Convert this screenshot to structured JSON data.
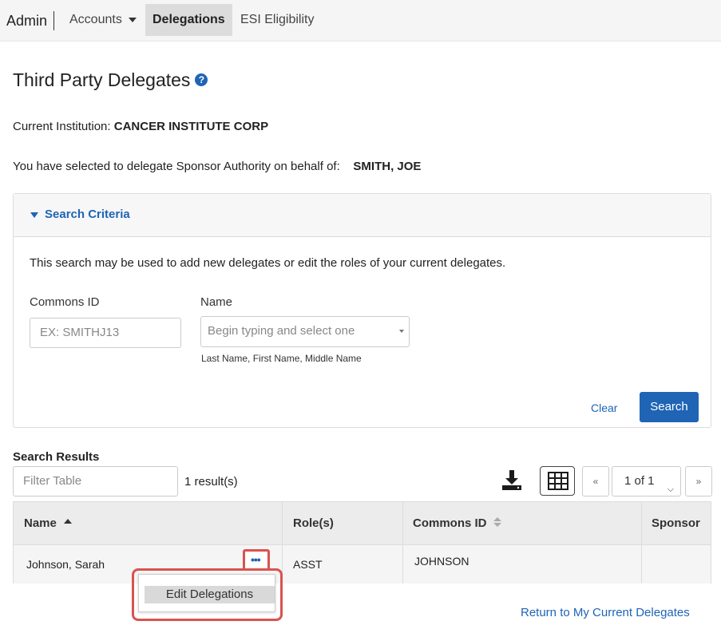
{
  "nav": {
    "brand": "Admin",
    "items": [
      {
        "label": "Accounts"
      },
      {
        "label": "Delegations"
      },
      {
        "label": "ESI Eligibility"
      }
    ]
  },
  "page": {
    "title": "Third Party Delegates",
    "institution_label": "Current Institution:",
    "institution_value": "CANCER INSTITUTE CORP",
    "delegate_label": "You have selected to delegate Sponsor Authority on behalf of:",
    "delegate_value": "SMITH, JOE"
  },
  "search_criteria": {
    "title": "Search Criteria",
    "description": "This search may be used to add new delegates or edit the roles of your current delegates.",
    "commons_id_label": "Commons ID",
    "commons_id_placeholder": "EX: SMITHJ13",
    "name_label": "Name",
    "name_placeholder": "Begin typing and select one",
    "name_hint": "Last Name, First Name, Middle Name",
    "clear_label": "Clear",
    "search_label": "Search"
  },
  "results": {
    "title": "Search Results",
    "filter_placeholder": "Filter Table",
    "count": "1 result(s)",
    "pagination": {
      "prev": "«",
      "current": "1 of 1",
      "next": "»"
    },
    "columns": [
      "Name",
      "Role(s)",
      "Commons ID",
      "Sponsor"
    ],
    "rows": [
      {
        "name": "Johnson, Sarah",
        "roles": "ASST",
        "commons_id": "JOHNSON",
        "sponsor": ""
      }
    ],
    "actions_label": "•••",
    "menu_items": [
      "Edit Delegations"
    ]
  },
  "return_link": "Return to My Current Delegates",
  "colors": {
    "accent": "#1f64b5",
    "highlight": "#d9534f"
  }
}
